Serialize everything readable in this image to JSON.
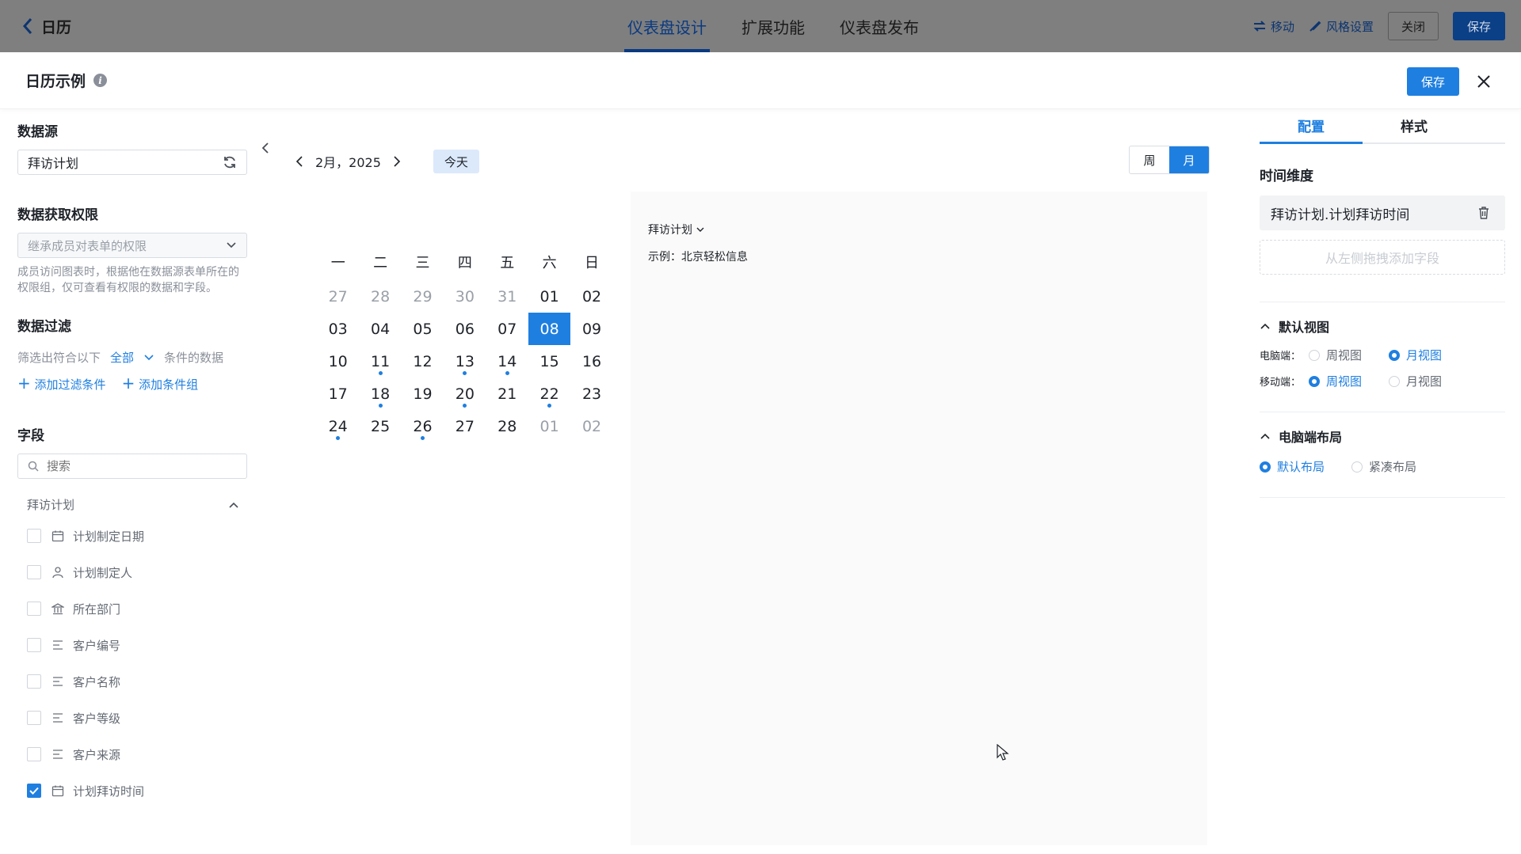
{
  "topbar": {
    "back_label": "日历",
    "tabs": [
      "仪表盘设计",
      "扩展功能",
      "仪表盘发布"
    ],
    "move_label": "移动",
    "style_label": "风格设置",
    "close_label": "关闭",
    "save_label": "保存"
  },
  "modal": {
    "title": "日历示例",
    "save_label": "保存"
  },
  "left": {
    "datasource_title": "数据源",
    "datasource_value": "拜访计划",
    "permission_title": "数据获取权限",
    "permission_value": "继承成员对表单的权限",
    "permission_hint": "成员访问图表时，根据他在数据源表单所在的权限组，仅可查看有权限的数据和字段。",
    "filter_title": "数据过滤",
    "filter_prefix": "筛选出符合以下",
    "filter_mode": "全部",
    "filter_suffix": "条件的数据",
    "add_filter": "添加过滤条件",
    "add_group": "添加条件组",
    "fields_title": "字段",
    "search_placeholder": "搜索",
    "group_name": "拜访计划",
    "fields": [
      {
        "label": "计划制定日期",
        "icon": "calendar-icon",
        "checked": false
      },
      {
        "label": "计划制定人",
        "icon": "person-icon",
        "checked": false
      },
      {
        "label": "所在部门",
        "icon": "building-icon",
        "checked": false
      },
      {
        "label": "客户编号",
        "icon": "text-lines-icon",
        "checked": false
      },
      {
        "label": "客户名称",
        "icon": "text-lines-icon",
        "checked": false
      },
      {
        "label": "客户等级",
        "icon": "text-lines-icon",
        "checked": false
      },
      {
        "label": "客户来源",
        "icon": "text-lines-icon",
        "checked": false
      },
      {
        "label": "计划拜访时间",
        "icon": "calendar-icon",
        "checked": true
      }
    ]
  },
  "calendar": {
    "month_label": "2月，2025",
    "today_label": "今天",
    "view_week": "周",
    "view_month": "月",
    "weekdays": [
      "一",
      "二",
      "三",
      "四",
      "五",
      "六",
      "日"
    ],
    "weeks": [
      [
        {
          "d": "27",
          "m": 1
        },
        {
          "d": "28",
          "m": 1
        },
        {
          "d": "29",
          "m": 1
        },
        {
          "d": "30",
          "m": 1
        },
        {
          "d": "31",
          "m": 1
        },
        {
          "d": "01"
        },
        {
          "d": "02"
        }
      ],
      [
        {
          "d": "03"
        },
        {
          "d": "04"
        },
        {
          "d": "05"
        },
        {
          "d": "06"
        },
        {
          "d": "07"
        },
        {
          "d": "08",
          "s": 1
        },
        {
          "d": "09"
        }
      ],
      [
        {
          "d": "10"
        },
        {
          "d": "11",
          "e": 1
        },
        {
          "d": "12"
        },
        {
          "d": "13",
          "e": 1
        },
        {
          "d": "14",
          "e": 1
        },
        {
          "d": "15"
        },
        {
          "d": "16"
        }
      ],
      [
        {
          "d": "17"
        },
        {
          "d": "18",
          "e": 1
        },
        {
          "d": "19"
        },
        {
          "d": "20",
          "e": 1
        },
        {
          "d": "21"
        },
        {
          "d": "22",
          "e": 1
        },
        {
          "d": "23"
        }
      ],
      [
        {
          "d": "24",
          "e": 1
        },
        {
          "d": "25"
        },
        {
          "d": "26",
          "e": 1
        },
        {
          "d": "27"
        },
        {
          "d": "28"
        },
        {
          "d": "01",
          "m": 1
        },
        {
          "d": "02",
          "m": 1
        }
      ]
    ],
    "event_group": "拜访计划",
    "event_item": "示例：北京轻松信息"
  },
  "right": {
    "tab_config": "配置",
    "tab_style": "样式",
    "time_dim_title": "时间维度",
    "time_dim_value": "拜访计划.计划拜访时间",
    "drop_hint": "从左侧拖拽添加字段",
    "default_view_title": "默认视图",
    "pc_label": "电脑端：",
    "mobile_label": "移动端：",
    "week_view": "周视图",
    "month_view": "月视图",
    "pc_layout_title": "电脑端布局",
    "layout_default": "默认布局",
    "layout_compact": "紧凑布局"
  },
  "colors": {
    "accent": "#1f7fe0",
    "overlay": "#7f7f7f"
  }
}
